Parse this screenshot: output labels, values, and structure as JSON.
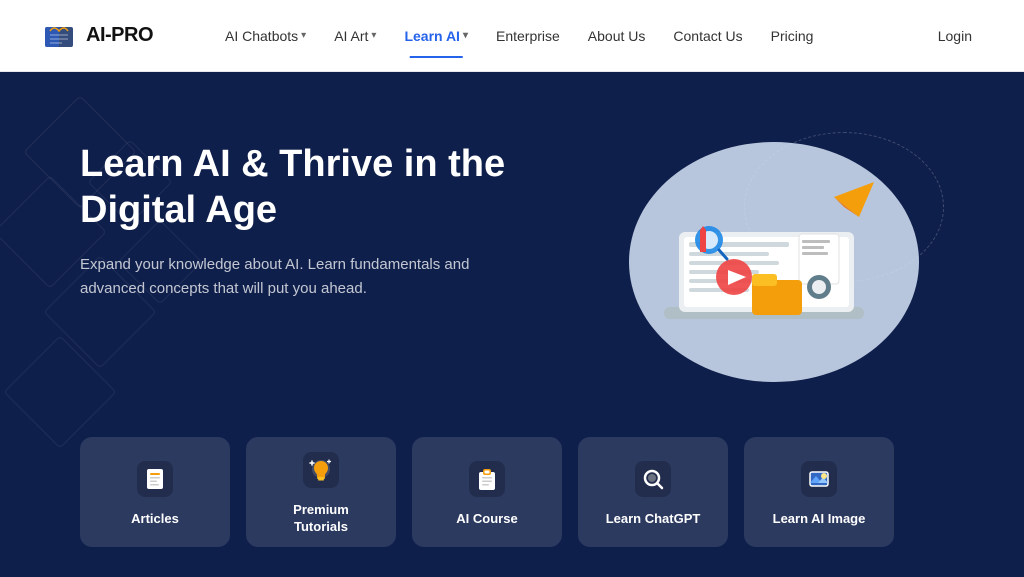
{
  "header": {
    "logo_text": "AI-PRO",
    "nav_items": [
      {
        "id": "ai-chatbots",
        "label": "AI Chatbots",
        "has_dropdown": true,
        "active": false
      },
      {
        "id": "ai-art",
        "label": "AI Art",
        "has_dropdown": true,
        "active": false
      },
      {
        "id": "learn-ai",
        "label": "Learn AI",
        "has_dropdown": true,
        "active": true
      },
      {
        "id": "enterprise",
        "label": "Enterprise",
        "has_dropdown": false,
        "active": false
      },
      {
        "id": "about-us",
        "label": "About Us",
        "has_dropdown": false,
        "active": false
      },
      {
        "id": "contact-us",
        "label": "Contact Us",
        "has_dropdown": false,
        "active": false
      },
      {
        "id": "pricing",
        "label": "Pricing",
        "has_dropdown": false,
        "active": false
      }
    ],
    "login_label": "Login"
  },
  "hero": {
    "title": "Learn AI & Thrive in the\nDigital Age",
    "subtitle": "Expand your knowledge about AI. Learn fundamentals and advanced concepts that will put you ahead.",
    "cards": [
      {
        "id": "articles",
        "label": "Articles",
        "icon": "📄",
        "icon_bg": "#f59e0b"
      },
      {
        "id": "premium-tutorials",
        "label": "Premium\nTutorials",
        "icon": "💡",
        "icon_bg": "#f59e0b"
      },
      {
        "id": "ai-course",
        "label": "AI  Course",
        "icon": "📋",
        "icon_bg": "#f59e0b"
      },
      {
        "id": "learn-chatgpt",
        "label": "Learn ChatGPT",
        "icon": "🔍",
        "icon_bg": "#6b7280"
      },
      {
        "id": "learn-ai-image",
        "label": "Learn AI Image",
        "icon": "🖼️",
        "icon_bg": "#3b82f6"
      }
    ]
  },
  "colors": {
    "nav_active": "#2563eb",
    "hero_bg": "#0f1f4b",
    "card_bg": "rgba(255,255,255,0.12)"
  }
}
